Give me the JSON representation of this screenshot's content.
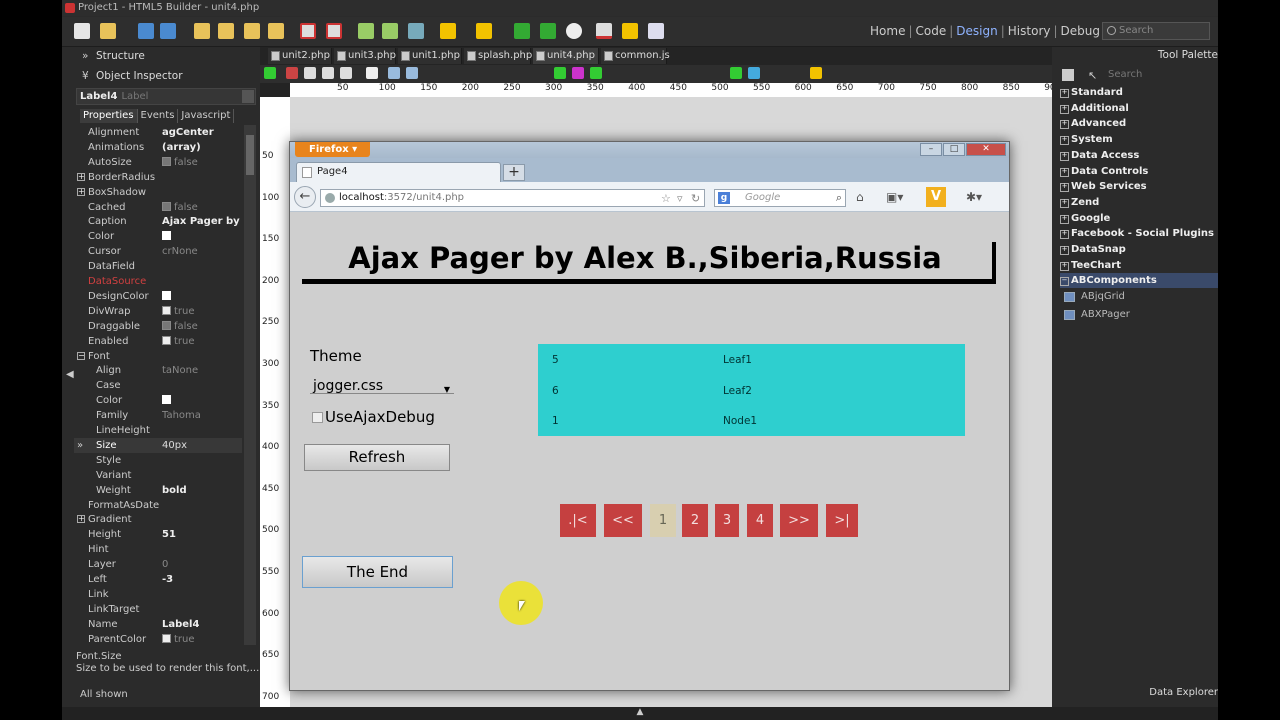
{
  "app": {
    "title": "Project1 - HTML5 Builder - unit4.php"
  },
  "nav": {
    "home": "Home",
    "code": "Code",
    "design": "Design",
    "history": "History",
    "debug": "Debug",
    "sep": "|",
    "search_placeholder": "Search"
  },
  "left": {
    "structure": "Structure",
    "object_inspector": "Object Inspector",
    "selected_name": "Label4",
    "selected_class": "Label",
    "tabs": [
      "Properties",
      "Events",
      "Javascript"
    ],
    "props": [
      {
        "name": "Alignment",
        "value": "agCenter",
        "bold": true
      },
      {
        "name": "Animations",
        "value": "(array)",
        "bold": true
      },
      {
        "name": "AutoSize",
        "value": "false",
        "check": "off"
      },
      {
        "name": "BorderRadius",
        "value": "",
        "expander": "+"
      },
      {
        "name": "BoxShadow",
        "value": "",
        "expander": "+"
      },
      {
        "name": "Cached",
        "value": "false",
        "check": "off"
      },
      {
        "name": "Caption",
        "value": "Ajax Pager by Alex B.,Siberia,Russia",
        "bold": true
      },
      {
        "name": "Color",
        "value": "",
        "check": "white"
      },
      {
        "name": "Cursor",
        "value": "crNone"
      },
      {
        "name": "DataField",
        "value": ""
      },
      {
        "name": "DataSource",
        "value": "",
        "red": true
      },
      {
        "name": "DesignColor",
        "value": "",
        "check": "white"
      },
      {
        "name": "DivWrap",
        "value": "true",
        "check": "on"
      },
      {
        "name": "Draggable",
        "value": "false",
        "check": "off"
      },
      {
        "name": "Enabled",
        "value": "true",
        "check": "on"
      },
      {
        "name": "Font",
        "value": "",
        "expander": "−"
      },
      {
        "name": "Align",
        "value": "taNone",
        "sub": true
      },
      {
        "name": "Case",
        "value": "",
        "sub": true
      },
      {
        "name": "Color",
        "value": "",
        "sub": true,
        "check": "white"
      },
      {
        "name": "Family",
        "value": "Tahoma",
        "sub": true
      },
      {
        "name": "LineHeight",
        "value": "",
        "sub": true
      },
      {
        "name": "Size",
        "value": "40px",
        "sub": true,
        "selected": true,
        "white": true
      },
      {
        "name": "Style",
        "value": "",
        "sub": true
      },
      {
        "name": "Variant",
        "value": "",
        "sub": true
      },
      {
        "name": "Weight",
        "value": "bold",
        "sub": true,
        "bold": true
      },
      {
        "name": "FormatAsDate",
        "value": ""
      },
      {
        "name": "Gradient",
        "value": "",
        "expander": "+"
      },
      {
        "name": "Height",
        "value": "51",
        "bold": true
      },
      {
        "name": "Hint",
        "value": ""
      },
      {
        "name": "Layer",
        "value": "0"
      },
      {
        "name": "Left",
        "value": "-3",
        "bold": true
      },
      {
        "name": "Link",
        "value": ""
      },
      {
        "name": "LinkTarget",
        "value": ""
      },
      {
        "name": "Name",
        "value": "Label4",
        "bold": true
      },
      {
        "name": "ParentColor",
        "value": "true",
        "check": "on"
      }
    ],
    "caption_title": "Font.Size",
    "caption_text": "Size to be used to render this font,...",
    "all_shown": "All shown"
  },
  "doc_tabs": [
    "unit2.php",
    "unit3.php",
    "unit1.php",
    "splash.php",
    "unit4.php",
    "common.js"
  ],
  "ruler_top": [
    "50",
    "100",
    "150",
    "200",
    "250",
    "300",
    "350",
    "400",
    "450",
    "500",
    "550",
    "600",
    "650",
    "700",
    "750",
    "800",
    "850",
    "90"
  ],
  "ruler_left": [
    "50",
    "100",
    "150",
    "200",
    "250",
    "300",
    "350",
    "400",
    "450",
    "500",
    "550",
    "600",
    "650",
    "700"
  ],
  "browser": {
    "menu_button": "Firefox",
    "tab_title": "Page4",
    "new_tab": "+",
    "url_host": "localhost",
    "url_path": ":3572/unit4.php",
    "search_engine_placeholder": "Google"
  },
  "page": {
    "heading": "Ajax Pager by Alex B.,Siberia,Russia",
    "theme_label": "Theme",
    "theme_value": "jogger.css",
    "debug_label": "UseAjaxDebug",
    "refresh_button": "Refresh",
    "end_button": "The End",
    "grid_rows": [
      {
        "id": "5",
        "name": "Leaf1"
      },
      {
        "id": "6",
        "name": "Leaf2"
      },
      {
        "id": "1",
        "name": "Node1"
      }
    ],
    "pager": [
      ".|<",
      "<<",
      "1",
      "2",
      "3",
      "4",
      ">>",
      ">|"
    ],
    "current_page": "1"
  },
  "right": {
    "title": "Tool Palette",
    "search_placeholder": "Search",
    "categories": [
      "Standard",
      "Additional",
      "Advanced",
      "System",
      "Data Access",
      "Data Controls",
      "Web Services",
      "Zend",
      "Google",
      "Facebook - Social Plugins",
      "DataSnap",
      "TeeChart",
      "ABComponents"
    ],
    "expanded_category": "ABComponents",
    "items": [
      "ABjqGrid",
      "ABXPager"
    ],
    "data_explorer": "Data Explorer"
  }
}
